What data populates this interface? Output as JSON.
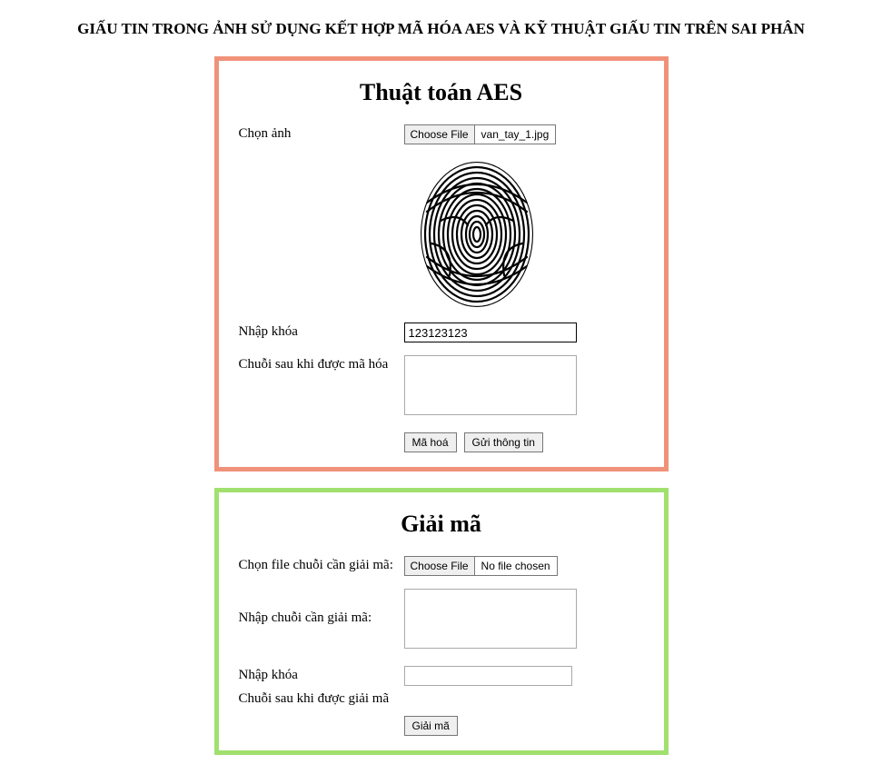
{
  "pageTitle": "GIẤU TIN TRONG ẢNH SỬ DỤNG KẾT HỢP MÃ HÓA AES VÀ KỸ THUẬT GIẤU TIN TRÊN SAI PHÂN",
  "aes": {
    "heading": "Thuật toán AES",
    "selectImageLabel": "Chọn ảnh",
    "fileButton": "Choose File",
    "fileName": "van_tay_1.jpg",
    "keyLabel": "Nhập khóa",
    "keyValue": "123123123",
    "encodedLabel": "Chuỗi sau khi được mã hóa",
    "encodedValue": "",
    "encryptBtn": "Mã hoá",
    "sendBtn": "Gửi thông tin"
  },
  "decode": {
    "heading": "Giải mã",
    "selectFileLabel": "Chọn file chuỗi cần giải mã:",
    "fileButton": "Choose File",
    "fileName": "No file chosen",
    "inputChainLabel": "Nhập chuỗi cần giải mã:",
    "inputChainValue": "",
    "keyLabel": "Nhập khóa",
    "keyValue": "",
    "decodedLabel": "Chuỗi sau khi được giải mã",
    "decodeBtn": "Giải mã"
  }
}
